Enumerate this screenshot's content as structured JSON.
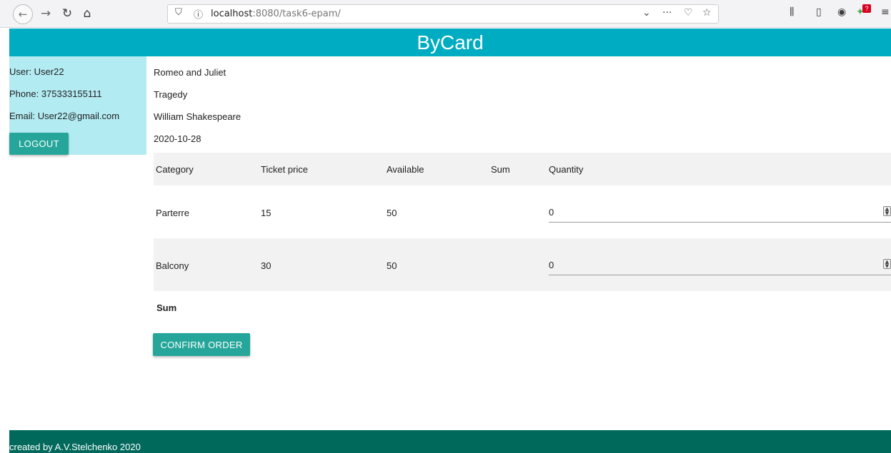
{
  "browser": {
    "url_host": "localhost",
    "url_rest": ":8080/task6-epam/",
    "icons": {
      "back": "back-arrow-icon",
      "forward": "forward-arrow-icon",
      "reload": "reload-icon",
      "home": "home-icon",
      "shield": "tracking-shield-icon",
      "info": "site-info-icon",
      "chevron": "chevron-down-icon",
      "more": "more-dots-icon",
      "pocket": "pocket-icon",
      "bookmark": "bookmark-star-icon",
      "library": "library-icon",
      "sidebar": "sidebar-icon",
      "account": "account-icon",
      "extension": "extension-icon",
      "menu": "hamburger-menu-icon"
    },
    "extension_badge": "?"
  },
  "header": {
    "title": "ByCard"
  },
  "user": {
    "name_line": "User: User22",
    "phone_line": "Phone: 375333155111",
    "email_line": "Email: User22@gmail.com",
    "logout_label": "LOGOUT"
  },
  "event": {
    "title": "Romeo and Juliet",
    "genre": "Tragedy",
    "author": "William Shakespeare",
    "date": "2020-10-28"
  },
  "table": {
    "headers": {
      "category": "Category",
      "price": "Ticket price",
      "available": "Available",
      "sum": "Sum",
      "quantity": "Quantity"
    },
    "rows": [
      {
        "category": "Parterre",
        "price": "15",
        "available": "50",
        "sum": "",
        "quantity": "0"
      },
      {
        "category": "Balcony",
        "price": "30",
        "available": "50",
        "sum": "",
        "quantity": "0"
      }
    ]
  },
  "order": {
    "sum_label": "Sum",
    "confirm_label": "CONFIRM ORDER"
  },
  "footer": {
    "text": "created by A.V.Stelchenko 2020"
  },
  "colors": {
    "header_bg": "#00acc1",
    "user_panel_bg": "#b2ebf2",
    "button_bg": "#26a69a",
    "footer_bg": "#00695c"
  }
}
